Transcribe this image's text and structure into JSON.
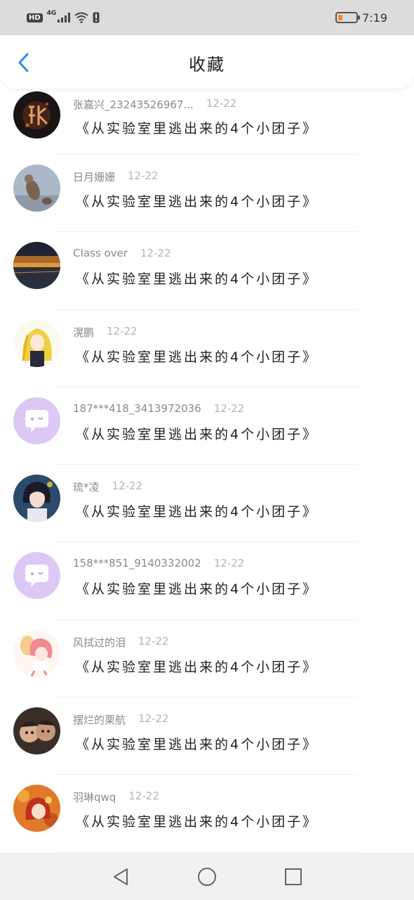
{
  "status": {
    "network": "4G",
    "hd": "HD",
    "time": "7:19",
    "battery_level": 0.25,
    "battery_color": "#f08a2a"
  },
  "header": {
    "title": "收藏"
  },
  "items": [
    {
      "author": "张嘉兴_23243526967...",
      "date": "12-22",
      "title": "《从实验室里逃出来的4个小团子》",
      "avatar": "calligraphy-dark"
    },
    {
      "author": "日月姗姗",
      "date": "12-22",
      "title": "《从实验室里逃出来的4个小团子》",
      "avatar": "cat-photo"
    },
    {
      "author": "CIass over",
      "date": "12-22",
      "title": "《从实验室里逃出来的4个小团子》",
      "avatar": "sunset-photo"
    },
    {
      "author": "滉鹏",
      "date": "12-22",
      "title": "《从实验室里逃出来的4个小团子》",
      "avatar": "anime-blonde"
    },
    {
      "author": "187***418_3413972036",
      "date": "12-22",
      "title": "《从实验室里逃出来的4个小团子》",
      "avatar": "default-chat"
    },
    {
      "author": "琉*凌",
      "date": "12-22",
      "title": "《从实验室里逃出来的4个小团子》",
      "avatar": "anime-dark-hair"
    },
    {
      "author": "158***851_9140332002",
      "date": "12-22",
      "title": "《从实验室里逃出来的4个小团子》",
      "avatar": "default-chat"
    },
    {
      "author": "风拭过的泪",
      "date": "12-22",
      "title": "《从实验室里逃出来的4个小团子》",
      "avatar": "anime-pink"
    },
    {
      "author": "摆烂的栗航",
      "date": "12-22",
      "title": "《从实验室里逃出来的4个小团子》",
      "avatar": "cartoon-faces"
    },
    {
      "author": "羽琳qwq",
      "date": "12-22",
      "title": "《从实验室里逃出来的4个小团子》",
      "avatar": "autumn-anime"
    }
  ],
  "accent_color": "#2f8ee8"
}
